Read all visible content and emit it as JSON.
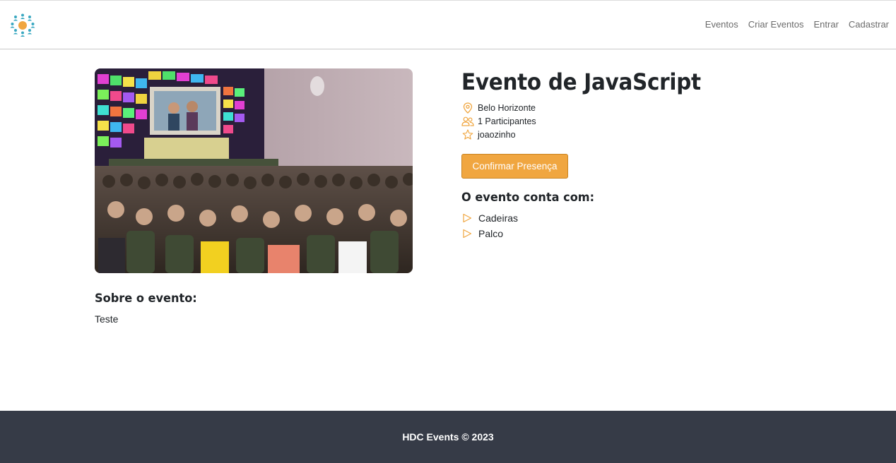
{
  "nav": {
    "logo": "hdc-events-logo",
    "links": [
      "Eventos",
      "Criar Eventos",
      "Entrar",
      "Cadastrar"
    ]
  },
  "event": {
    "image": "event-crowd-photo",
    "title": "Evento de JavaScript",
    "city": "Belo Horizonte",
    "participants": "1 Participantes",
    "owner": "joaozinho",
    "confirm_label": "Confirmar Presença",
    "features_title": "O evento conta com:",
    "features": [
      "Cadeiras",
      "Palco"
    ],
    "about_title": "Sobre o evento:",
    "about_text": "Teste"
  },
  "icons": {
    "city": "location-pin-icon",
    "participants": "people-icon",
    "owner": "star-icon",
    "feature": "play-outline-icon"
  },
  "colors": {
    "accent": "#f0a640",
    "accent_border": "#c98422",
    "footer_bg": "#363b47",
    "logo_teal": "#3aa8c1"
  },
  "footer": {
    "text": "HDC Events © 2023"
  }
}
